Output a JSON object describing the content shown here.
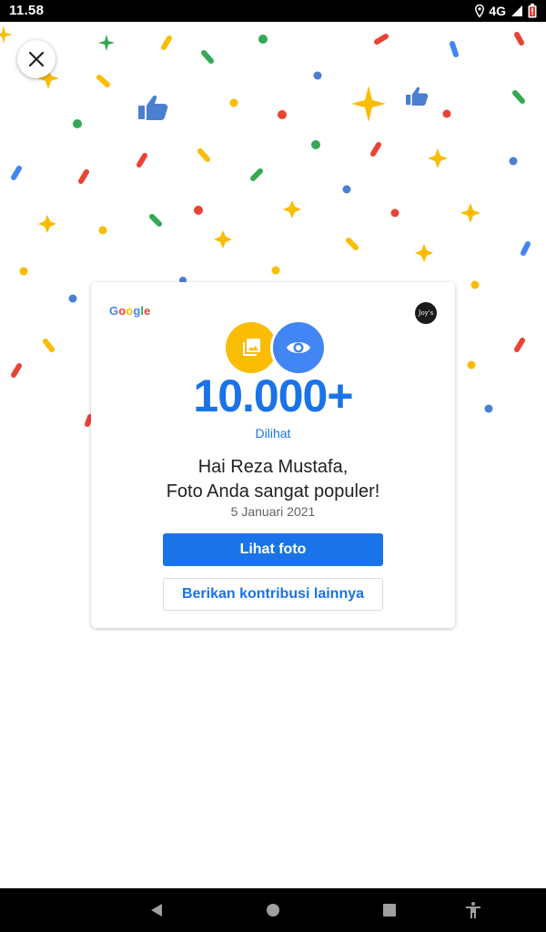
{
  "status_bar": {
    "time": "11.58",
    "network": "4G",
    "network_sup": "4G"
  },
  "close_button": {
    "icon": "close-icon"
  },
  "card": {
    "brand": [
      "G",
      "o",
      "o",
      "g",
      "l",
      "e"
    ],
    "avatar_text": "Joy's",
    "count": "10.000+",
    "count_label": "Dilihat",
    "greeting_line1": "Hai Reza Mustafa,",
    "greeting_line2": "Foto Anda sangat populer!",
    "date": "5 Januari 2021",
    "primary_button": "Lihat foto",
    "secondary_button": "Berikan kontribusi lainnya"
  },
  "colors": {
    "blue": "#4285F4",
    "red": "#EA4335",
    "yellow": "#FBBC04",
    "green": "#34A853",
    "link_blue": "#1a73e8"
  },
  "nav_bar": {
    "icons": [
      "back-icon",
      "home-icon",
      "recents-icon",
      "accessibility-icon"
    ]
  }
}
